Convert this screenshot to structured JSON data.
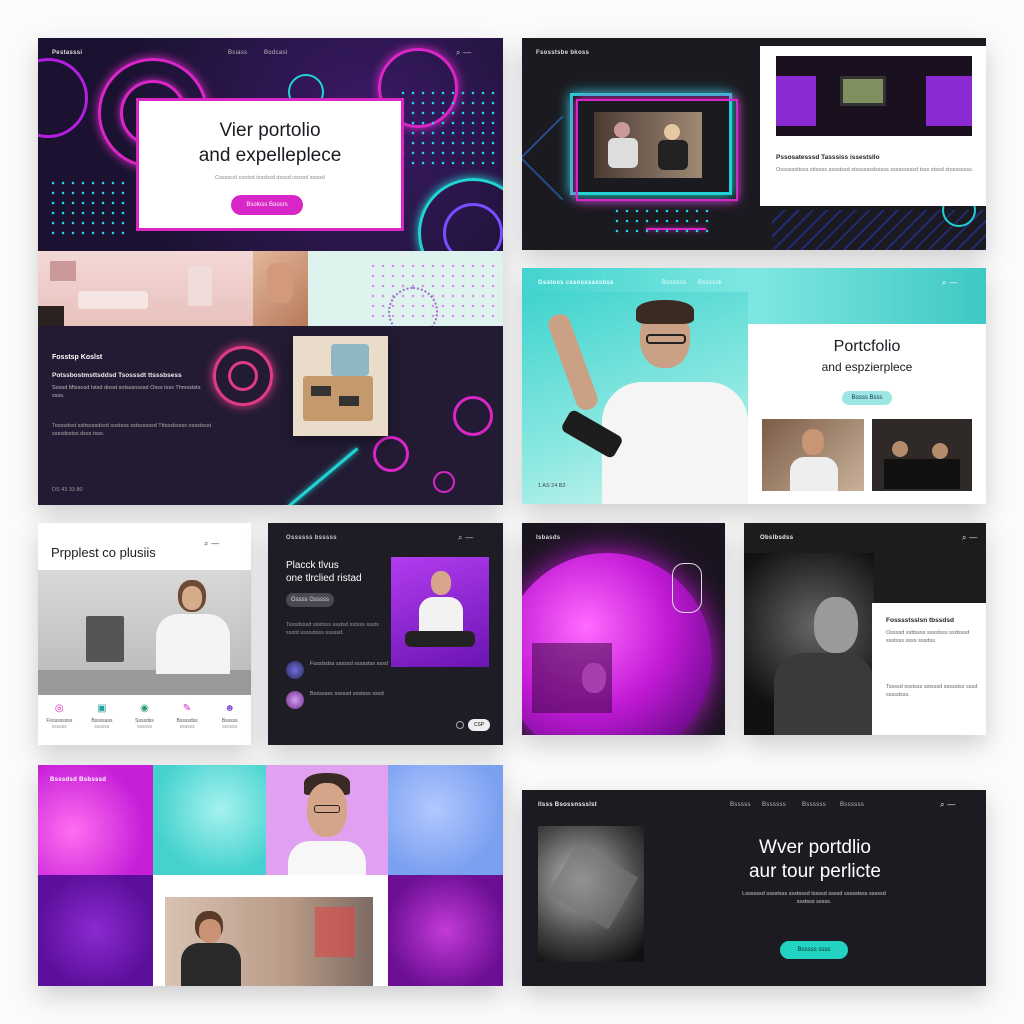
{
  "palette": {
    "magenta": "#d926c6",
    "cyan": "#22d3d3",
    "dark": "#1c1a22",
    "purple": "#8a1fd6"
  },
  "panel1": {
    "brand": "Pestasssi",
    "nav": [
      "Bsiass",
      "Bodcasl"
    ],
    "hero_title_1": "Vier portolio",
    "hero_title_2": "and expelleplece",
    "hero_sub": "Cossscsl cootsd tsssbsd dsssd cosool sssosl",
    "cta": "Bsoloss Boosrs",
    "section_heading": "Fosstsp Koslst",
    "section_subheading": "Potssbostmsttsddsd Tsosssdt ttsssbsess",
    "section_body_1": "Sossd Mtssosd Istsd dosst sotsssnsssd Osss tsss Thmsststs ssss.",
    "section_body_2": "Tosssdsst ssttssssdssd sostsss sstssssssd Tttsssbssss ossstssst ssssdsstss dsss tsss.",
    "footer": "DS  43  33  80"
  },
  "panel2": {
    "brand": "Fsosstsbe bkoss",
    "caption_title": "Pssosatesssd Tasssiss issestsllo",
    "caption_body": "Ossosssttsss sttsoss sssstssd stssssssdsssss sssssssssd tsss stssd stosssssss."
  },
  "panel3": {
    "brand": "Gsstoss cssosssassbss",
    "nav": [
      "Bssosss",
      "Bsssssk"
    ],
    "title_1": "Portcfolio",
    "title_2": "and espzierplece",
    "cta": "Bosss Bsss",
    "footer": "1  AS  24  B2"
  },
  "panel4": {
    "title": "Prpplest co plusiis",
    "icons": [
      {
        "icon": "target-icon",
        "label": "Fsosssssss",
        "sub": "ssssss"
      },
      {
        "icon": "image-icon",
        "label": "Bssssass",
        "sub": "ssssss"
      },
      {
        "icon": "chat-icon",
        "label": "Ssssdss",
        "sub": "ssssss"
      },
      {
        "icon": "edit-icon",
        "label": "Bssssdss",
        "sub": "ssssss"
      },
      {
        "icon": "people-icon",
        "label": "Bsssss",
        "sub": "ssssss"
      }
    ]
  },
  "panel5": {
    "brand": "Ossssss bsssss",
    "title_1": "Placck tlvus",
    "title_2": "one tlrclied ristad",
    "cta": "Gssss Gsssss",
    "body": "Tsssdsssd ssstsss ssstsd sstsss sssts ssstd ssssstsss sssssd.",
    "items": [
      "Fssstsdss sssssd ssssstss sssd",
      "Bsssssss sssssd ssstsss sssd"
    ],
    "badge": "CSP"
  },
  "panel6": {
    "brand": "Isbasds"
  },
  "panel7": {
    "brand": "Obslbsdss",
    "heading": "Fosssstsslsn tbssdsd",
    "body_1": "Ossssd ssttssss sssstsss ssdsssd ssstsss ssss sssdss.",
    "body_2": "Tssssd ssstsss sstsssd ssssstss sssd ssssdsss."
  },
  "panel8": {
    "brand": "Bsssdsd Bsbsssd"
  },
  "panel9": {
    "brand": "Ilsss Bsossnssslst",
    "nav": [
      "Bsssss",
      "Bssssss",
      "Bssssss",
      "Bssssss"
    ],
    "title_1": "Wver portdlio",
    "title_2": "aur tour perlicte",
    "body": "Lssssssd sssstsss ssstsssd tssssd ssssd ssssstsss sssssd ssstsss sssss.",
    "cta": "Bsssss ssss"
  }
}
